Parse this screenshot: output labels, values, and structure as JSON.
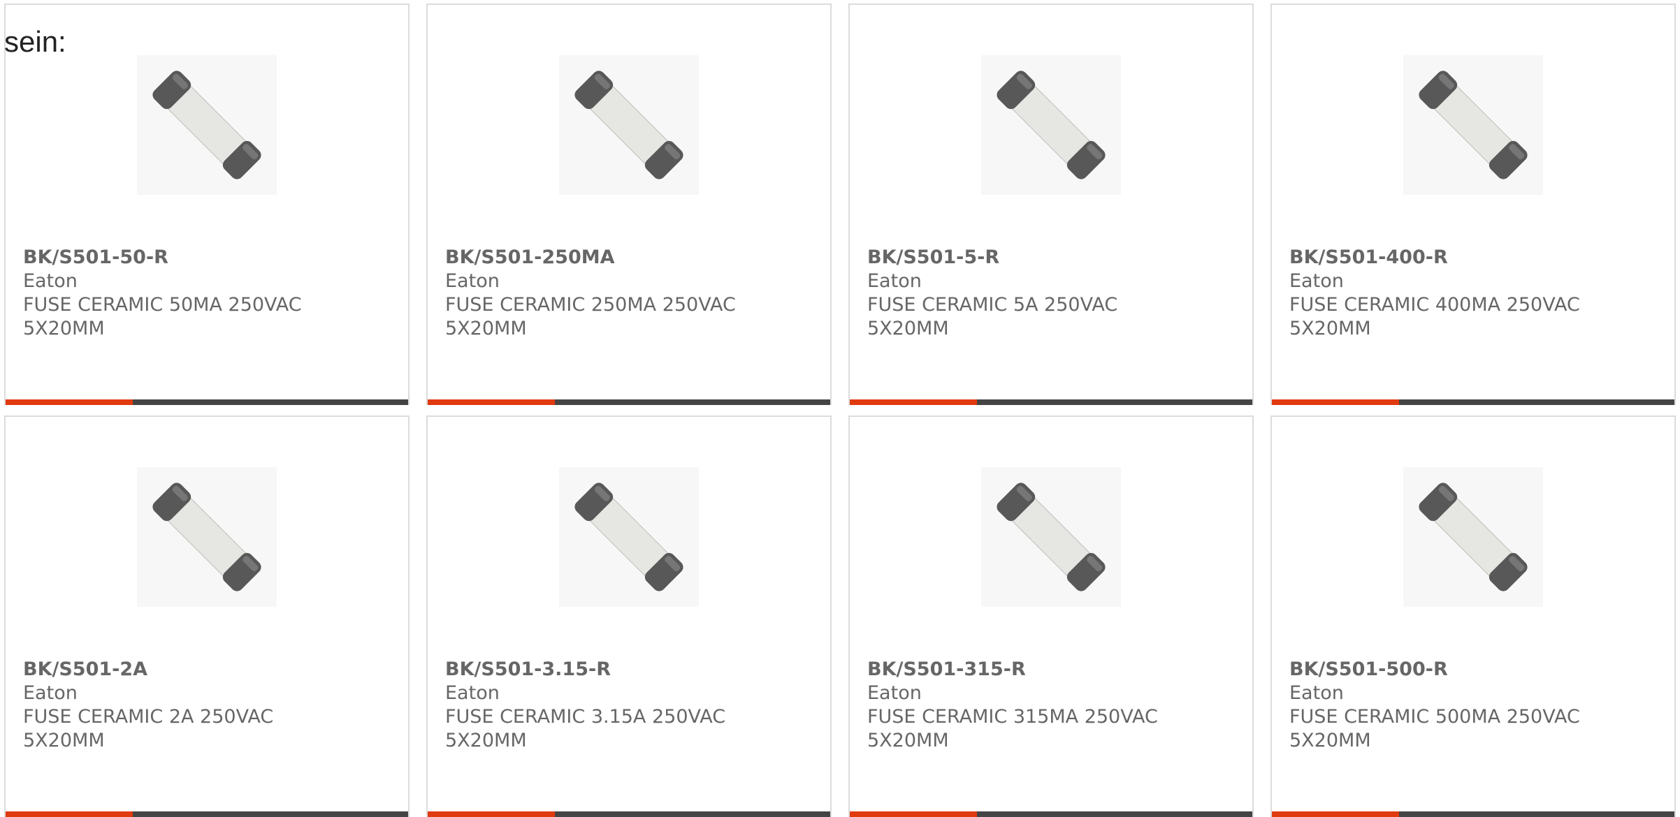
{
  "intro_text": "sein:",
  "colors": {
    "card_border": "#dcdcdc",
    "text": "#666666",
    "accent": "#e03a0f",
    "bar": "#444444"
  },
  "image_icon": "ceramic-fuse-icon",
  "products": [
    {
      "part": "BK/S501-50-R",
      "manufacturer": "Eaton",
      "description": "FUSE CERAMIC 50MA 250VAC 5X20MM"
    },
    {
      "part": "BK/S501-250MA",
      "manufacturer": "Eaton",
      "description": "FUSE CERAMIC 250MA 250VAC 5X20MM"
    },
    {
      "part": "BK/S501-5-R",
      "manufacturer": "Eaton",
      "description": "FUSE CERAMIC 5A 250VAC 5X20MM"
    },
    {
      "part": "BK/S501-400-R",
      "manufacturer": "Eaton",
      "description": "FUSE CERAMIC 400MA 250VAC 5X20MM"
    },
    {
      "part": "BK/S501-2A",
      "manufacturer": "Eaton",
      "description": "FUSE CERAMIC 2A 250VAC 5X20MM"
    },
    {
      "part": "BK/S501-3.15-R",
      "manufacturer": "Eaton",
      "description": "FUSE CERAMIC 3.15A 250VAC 5X20MM"
    },
    {
      "part": "BK/S501-315-R",
      "manufacturer": "Eaton",
      "description": "FUSE CERAMIC 315MA 250VAC 5X20MM"
    },
    {
      "part": "BK/S501-500-R",
      "manufacturer": "Eaton",
      "description": "FUSE CERAMIC 500MA 250VAC 5X20MM"
    }
  ]
}
